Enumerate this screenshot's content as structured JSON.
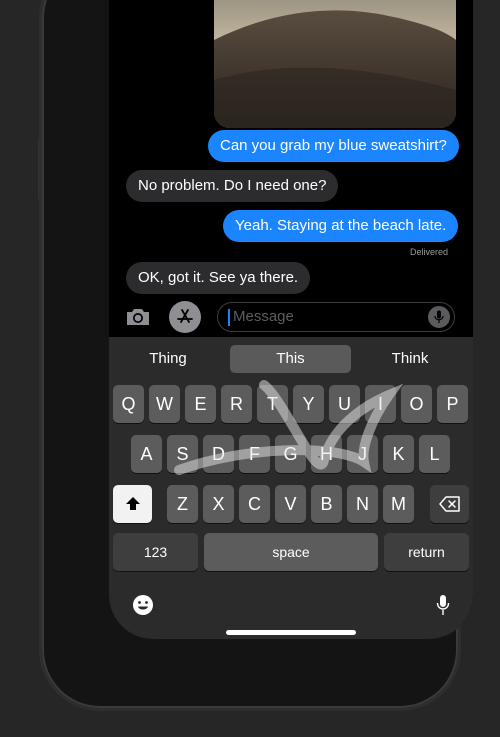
{
  "messages": [
    {
      "text": "Can you grab my blue sweatshirt?",
      "sender": "me"
    },
    {
      "text": "No problem. Do I need one?",
      "sender": "them"
    },
    {
      "text": "Yeah. Staying at the beach late.",
      "sender": "me"
    },
    {
      "text": "OK, got it. See ya there.",
      "sender": "them"
    }
  ],
  "status": {
    "delivered": "Delivered"
  },
  "compose": {
    "placeholder": "Message"
  },
  "suggestions": [
    "Thing",
    "This",
    "Think"
  ],
  "keyboard": {
    "row1": [
      "Q",
      "W",
      "E",
      "R",
      "T",
      "Y",
      "U",
      "I",
      "O",
      "P"
    ],
    "row2": [
      "A",
      "S",
      "D",
      "F",
      "G",
      "H",
      "J",
      "K",
      "L"
    ],
    "row3": [
      "Z",
      "X",
      "C",
      "V",
      "B",
      "N",
      "M"
    ],
    "numbers_label": "123",
    "space_label": "space",
    "return_label": "return"
  },
  "icons": {
    "camera": "camera-icon",
    "appstore": "app-store-icon",
    "mic": "microphone-icon",
    "emoji": "emoji-icon",
    "shift": "shift-icon",
    "backspace": "backspace-icon",
    "dictation": "dictation-icon"
  },
  "colors": {
    "bubble_sent": "#1a85ff",
    "bubble_received": "#2c2c2e",
    "keyboard_bg": "#2b2b2b"
  }
}
